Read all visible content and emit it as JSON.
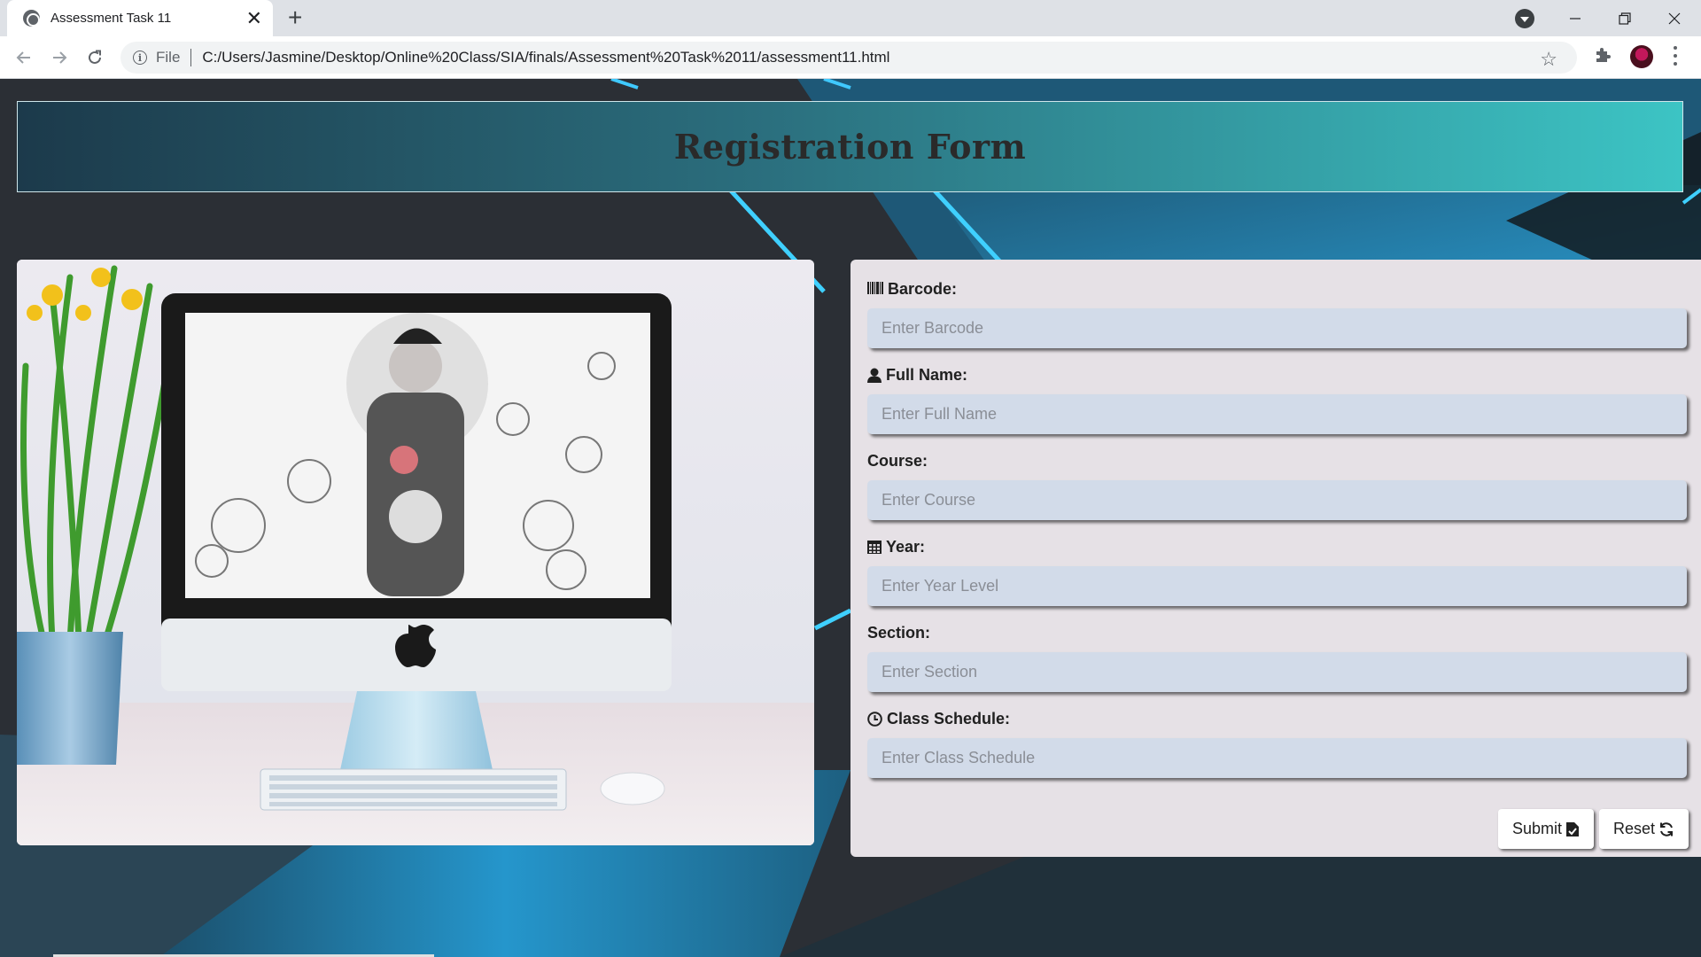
{
  "browser": {
    "tab_title": "Assessment Task 11",
    "tab_close": "✕",
    "new_tab": "+",
    "address_scheme": "File",
    "address_url": "C:/Users/Jasmine/Desktop/Online%20Class/SIA/finals/Assessment%20Task%2011/assessment11.html",
    "bookmark_star": "☆"
  },
  "page": {
    "title": "Registration Form",
    "fields": [
      {
        "label": "Barcode:",
        "placeholder": "Enter Barcode",
        "icon": "barcode-icon"
      },
      {
        "label": "Full Name:",
        "placeholder": "Enter Full Name",
        "icon": "user-icon"
      },
      {
        "label": "Course:",
        "placeholder": "Enter Course",
        "icon": ""
      },
      {
        "label": "Year:",
        "placeholder": "Enter Year Level",
        "icon": "calendar-icon"
      },
      {
        "label": "Section:",
        "placeholder": "Enter Section",
        "icon": ""
      },
      {
        "label": "Class Schedule:",
        "placeholder": "Enter Class Schedule",
        "icon": "clock-icon"
      }
    ],
    "buttons": {
      "submit": "Submit",
      "reset": "Reset"
    }
  },
  "colors": {
    "header_gradient_start": "#1c3a4b",
    "header_gradient_end": "#3cc4c4",
    "form_panel": "#e6e1e6",
    "input_bg": "#d2dbe9",
    "page_bg": "#2a2e33",
    "accent_stripe": "#29b6f6"
  }
}
